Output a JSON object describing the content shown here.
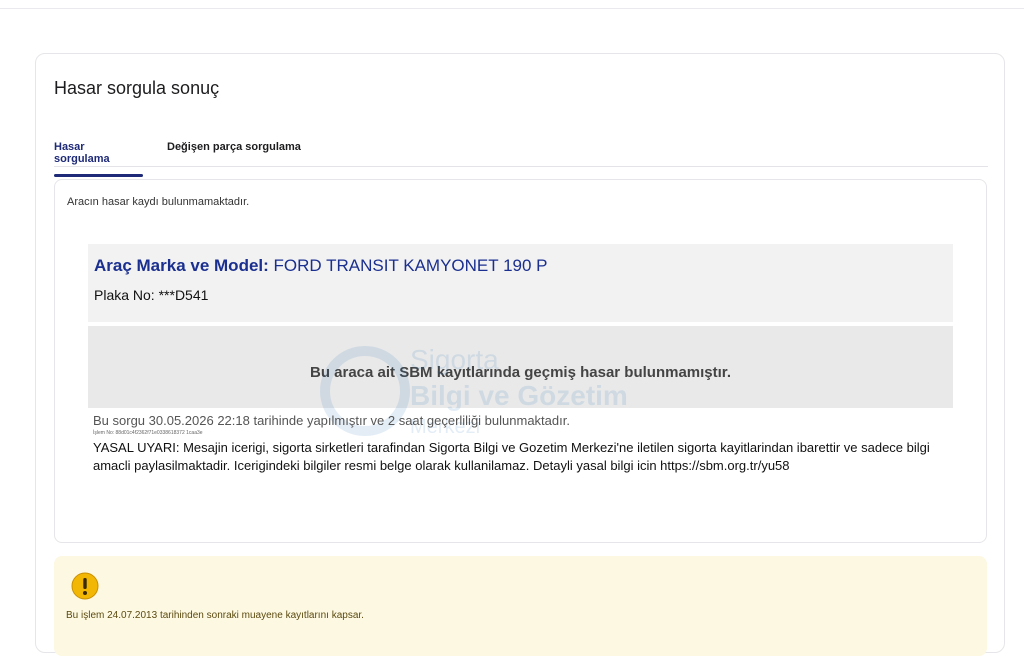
{
  "page": {
    "title": "Hasar sorgula sonuç"
  },
  "tabs": [
    {
      "label": "Hasar sorgulama",
      "active": true
    },
    {
      "label": "Değişen parça sorgulama",
      "active": false
    }
  ],
  "result": {
    "no_record_text": "Aracın hasar kaydı bulunmamaktadır.",
    "vehicle_label": "Araç Marka ve Model:",
    "vehicle_value": "FORD TRANSIT KAMYONET 190 P",
    "plate_label": "Plaka No:",
    "plate_value": "***D541",
    "sbm_result": "Bu araca ait SBM kayıtlarında geçmiş hasar bulunmamıştır.",
    "query_info": "Bu sorgu 30.05.2026 22:18 tarihinde yapılmıştır ve 2 saat geçerliliği bulunmaktadır.",
    "transaction_no": "İşlem No: 88d01c4f2362f71e0338618372 1caa3e",
    "legal_warning": "YASAL UYARI: Mesajin icerigi, sigorta sirketleri tarafindan Sigorta Bilgi ve Gozetim Merkezi'ne iletilen sigorta kayitlarindan ibarettir ve sadece bilgi amacli paylasilmaktadir. Icerigindeki bilgiler resmi belge olarak kullanilamaz. Detayli yasal bilgi icin https://sbm.org.tr/yu58"
  },
  "watermark": {
    "line1": "Sigorta",
    "line2": "Bilgi ve Gözetim",
    "line3": "Merkezi"
  },
  "notice": {
    "icon": "warning-icon",
    "text": "Bu işlem 24.07.2013 tarihinden sonraki muayene kayıtlarını kapsar."
  },
  "colors": {
    "accent": "#1e2a78",
    "vehicle_text": "#1a2f8f",
    "notice_bg": "#fdf8e1",
    "warning_yellow": "#f2b705"
  }
}
